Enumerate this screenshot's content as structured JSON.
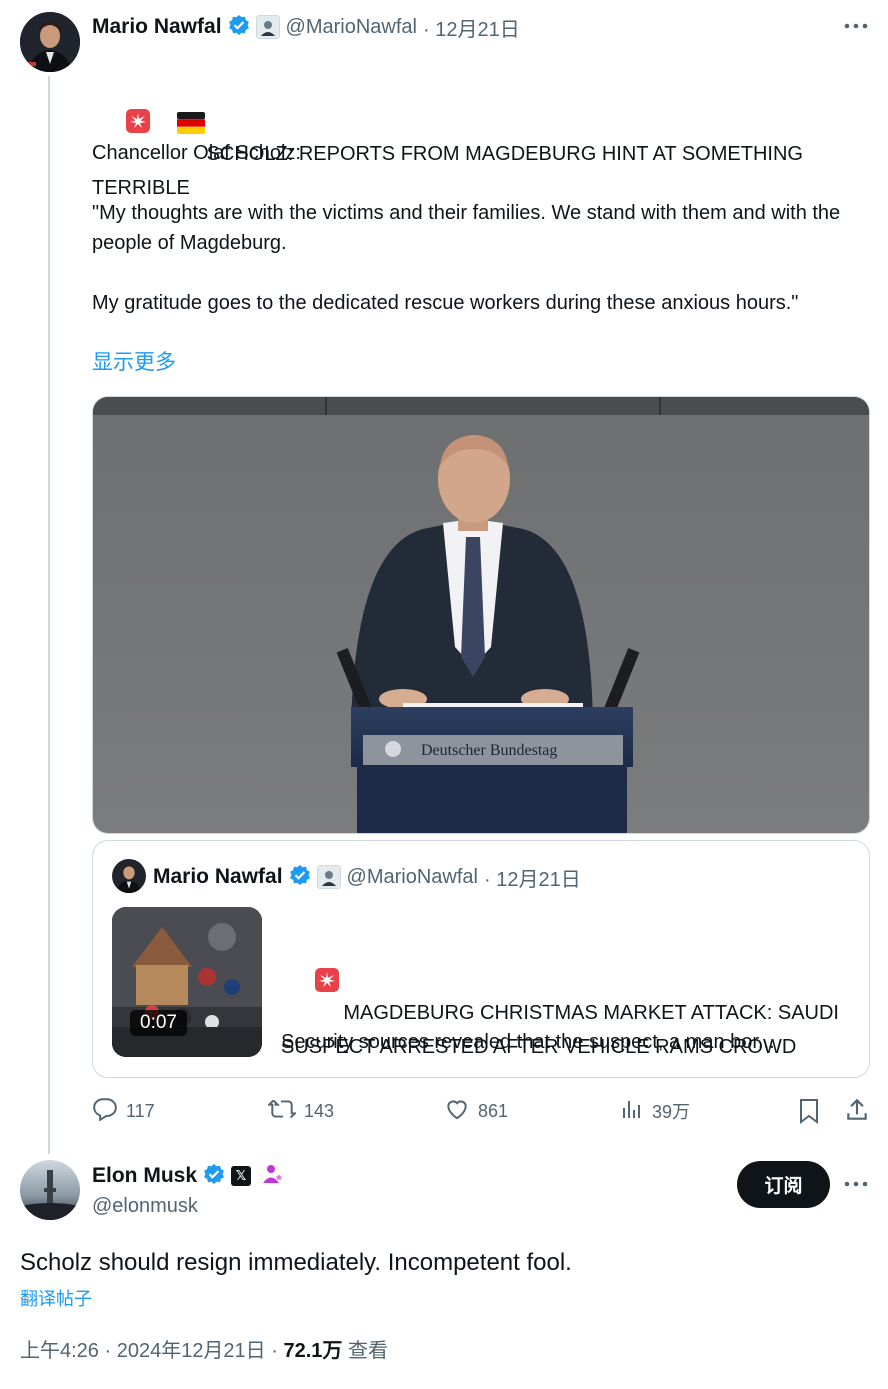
{
  "tweet1": {
    "author_name": "Mario Nawfal",
    "handle": "@MarioNawfal",
    "date": "· 12月21日",
    "headline": "SCHOLZ: REPORTS FROM MAGDEBURG HINT AT SOMETHING TERRIBLE",
    "body": "Chancellor Olaf Scholz:\n\n\"My thoughts are with the victims and their families. We stand with them and with the people of Magdeburg.\n\nMy gratitude goes to the dedicated rescue workers during these anxious hours.\"",
    "show_more": "显示更多",
    "media_lectern_text": "Deutscher Bundestag"
  },
  "quote": {
    "author_name": "Mario Nawfal",
    "handle": "@MarioNawfal",
    "date": "· 12月21日",
    "headline": "MAGDEBURG CHRISTMAS MARKET ATTACK: SAUDI SUSPECT ARRESTED AFTER VEHICLE RAMS CROWD",
    "snippet": "Security sources revealed that the suspect, a man bor...",
    "video_duration": "0:07"
  },
  "actions": {
    "replies": "117",
    "reposts": "143",
    "likes": "861",
    "views": "39万"
  },
  "tweet2": {
    "author_name": "Elon Musk",
    "handle": "@elonmusk",
    "subscribe_label": "订阅",
    "text": "Scholz should resign immediately. Incompetent fool.",
    "translate_label": "翻译帖子",
    "time": "上午4:26 · 2024年12月21日 · ",
    "view_count": "72.1万",
    "views_label": " 查看"
  },
  "colors": {
    "accent": "#1d9bf0",
    "text": "#0f1419",
    "muted": "#536471",
    "border": "#cfd9de"
  },
  "icons": [
    "verified-badge-icon",
    "more-icon",
    "alarm-light-icon",
    "german-flag-icon",
    "reply-icon",
    "repost-icon",
    "like-icon",
    "views-icon",
    "bookmark-icon",
    "share-icon",
    "x-logo-icon"
  ]
}
